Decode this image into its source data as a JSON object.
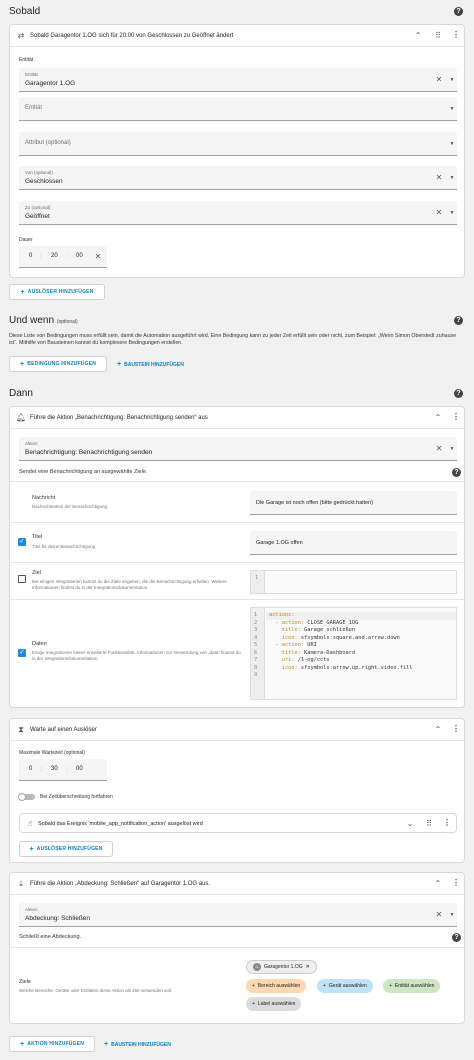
{
  "sobald": {
    "title": "Sobald",
    "trigger": {
      "title": "Sobald Garagentor 1.OG sich für 20:00 von Geschlossen zu Geöffnet ändert",
      "entity_section_label": "Entität",
      "entity_field_label": "Entität",
      "entity_value": "Garagentor 1.OG",
      "entity2_placeholder": "Entität",
      "attribute_placeholder": "Attribut (optional)",
      "from_label": "Von (optional)",
      "from_value": "Geschlossen",
      "to_label": "Zu (optional)",
      "to_value": "Geöffnet",
      "duration_label": "Dauer",
      "duration": {
        "h": "0",
        "m": "20",
        "s": "00"
      }
    },
    "add_trigger_label": "AUSLÖSER HINZUFÜGEN"
  },
  "und_wenn": {
    "title": "Und wenn",
    "optional": "(optional)",
    "description": "Diese Liste von Bedingungen muss erfüllt sein, damit die Automation ausgeführt wird. Eine Bedingung kann zu jeder Zeit erfüllt sein oder nicht, zum Beispiel: „Wenn Simon Oberstedt zuhause ist“. Mithilfe von Bausteinen kannst du komplexere Bedingungen erstellen.",
    "add_condition_label": "BEDINGUNG HINZUFÜGEN",
    "add_block_label": "BAUSTEIN HINZUFÜGEN"
  },
  "dann": {
    "title": "Dann",
    "action1": {
      "title": "Führe die Aktion „Benachrichtigung: Benachrichtigung senden“ aus",
      "action_label": "Aktion",
      "action_value": "Benachrichtigung: Benachrichtigung senden",
      "description": "Sendet eine Benachrichtigung an ausgewählte Ziele.",
      "message": {
        "label": "Nachricht",
        "hint": "Nachrichtentext der Benachrichtigung",
        "value": "Die Garage ist noch offen (bitte gedrückt halten)"
      },
      "title_field": {
        "label": "Titel",
        "hint": "Titel für deine Benachrichtigung",
        "value": "Garage 1.OG offen"
      },
      "target": {
        "label": "Ziel",
        "hint": "Bei einigen Integrationen kannst du die Ziele angeben, die die Benachrichtigung erhalten. Weitere Informationen findest du in der Integrationsdokumentation.",
        "line_no": "1"
      },
      "data": {
        "label": "Daten",
        "hint": "Einige Integrationen bieten erweiterte Funktionalität. Informationen zur Verwendung von „data“ findest du in der Integrationsdokumentation.",
        "lines": [
          {
            "n": "1",
            "text": "actions:"
          },
          {
            "n": "2",
            "text": "  - action: CLOSE_GARAGE_1OG"
          },
          {
            "n": "3",
            "text": "    title: Garage schließen"
          },
          {
            "n": "4",
            "text": "    icon: sfsymbols:square.and.arrow.down"
          },
          {
            "n": "5",
            "text": "  - action: URI"
          },
          {
            "n": "6",
            "text": "    title: Kamera-Dashboard"
          },
          {
            "n": "7",
            "text": "    uri: /1-og/cctv"
          },
          {
            "n": "8",
            "text": "    icon: sfsymbols:arrow.up.right.video.fill"
          },
          {
            "n": "9",
            "text": ""
          }
        ]
      }
    },
    "action2": {
      "title": "Warte auf einen Auslöser",
      "timeout_label": "Maximale Wartezeit (optional)",
      "timeout": {
        "h": "0",
        "m": "30",
        "s": "00"
      },
      "continue_label": "Bei Zeitüberschreitung fortfahren",
      "nested_trigger": "Sobald das Ereignis 'mobile_app_notification_action' ausgelöst wird",
      "add_trigger_label": "AUSLÖSER HINZUFÜGEN"
    },
    "action3": {
      "title": "Führe die Aktion „Abdeckung: Schließen“ auf Garagentor 1.OG aus.",
      "action_label": "Aktion",
      "action_value": "Abdeckung: Schließen",
      "description": "Schließt eine Abdeckung.",
      "targets_label": "Ziele",
      "targets_hint": "Welche Bereiche, Geräte oder Entitäten diese Aktion als Ziel verwenden soll.",
      "selected_entity": "Garagentor 1.OG",
      "chips": {
        "area": "Bereich auswählen",
        "device": "Gerät auswählen",
        "entity": "Entität auswählen",
        "label": "Label auswählen"
      }
    },
    "add_action_label": "AKTION HINZUFÜGEN",
    "add_block_label": "BAUSTEIN HINZUFÜGEN"
  },
  "colors": {
    "accent": "#0a7fc4",
    "checkbox": "#1e88e5",
    "chip_area": "#fbd8b0",
    "chip_device": "#bfe3f5",
    "chip_entity": "#cfe6c4",
    "chip_label": "#dcdcdc"
  }
}
